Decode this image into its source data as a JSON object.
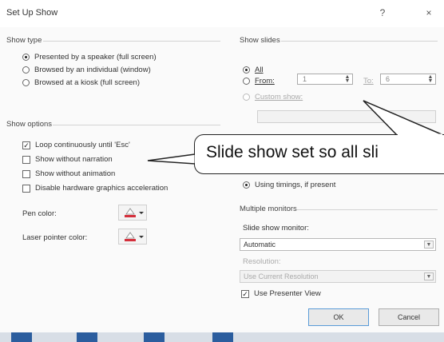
{
  "window": {
    "title": "Set Up Show",
    "help_btn": "?",
    "close_btn": "×"
  },
  "show_type": {
    "label": "Show type",
    "options": [
      {
        "label": "Presented by a speaker (full screen)",
        "selected": true
      },
      {
        "label": "Browsed by an individual (window)",
        "selected": false
      },
      {
        "label": "Browsed at a kiosk (full screen)",
        "selected": false
      }
    ]
  },
  "show_options": {
    "label": "Show options",
    "items": [
      {
        "label": "Loop continuously until 'Esc'",
        "checked": true
      },
      {
        "label": "Show without narration",
        "checked": false
      },
      {
        "label": "Show without animation",
        "checked": false
      },
      {
        "label": "Disable hardware graphics acceleration",
        "checked": false
      }
    ],
    "pen_color_label": "Pen color:",
    "pen_color": "#d4303c",
    "laser_color_label": "Laser pointer color:",
    "laser_color": "#d4303c"
  },
  "show_slides": {
    "label": "Show slides",
    "all_label": "All",
    "from_label": "From:",
    "from_value": "1",
    "to_label": "To:",
    "to_value": "6",
    "custom_label": "Custom show:"
  },
  "advance": {
    "timings_label": "Using timings, if present"
  },
  "multiple_monitors": {
    "label": "Multiple monitors",
    "monitor_label": "Slide show monitor:",
    "monitor_value": "Automatic",
    "resolution_label": "Resolution:",
    "resolution_value": "Use Current Resolution",
    "presenter_view_label": "Use Presenter View"
  },
  "buttons": {
    "ok": "OK",
    "cancel": "Cancel"
  },
  "callout": {
    "text": "Slide show set so all sli"
  },
  "colors": {
    "accent": "#5a9bd8",
    "taskbar": "#2b5d9e"
  }
}
